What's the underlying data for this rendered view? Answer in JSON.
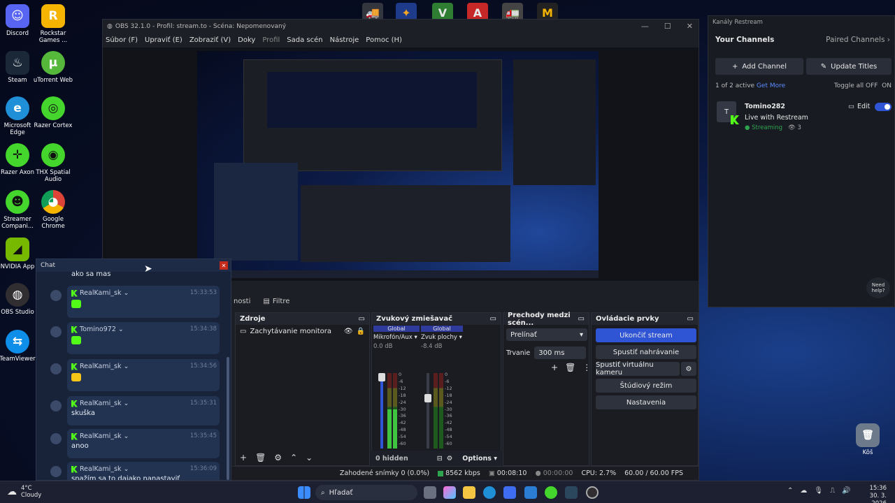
{
  "desktop": {
    "icons": [
      {
        "label": "Discord",
        "color": "#5865f2",
        "glyph": "☺"
      },
      {
        "label": "Rockstar Games ...",
        "color": "#f5b400",
        "glyph": "R"
      },
      {
        "label": "Steam",
        "color": "#1b2838",
        "glyph": "♨"
      },
      {
        "label": "uTorrent Web",
        "color": "#55b83a",
        "glyph": "μ"
      },
      {
        "label": "Microsoft Edge",
        "color": "#1f8fd8",
        "glyph": "e"
      },
      {
        "label": "Razer Cortex",
        "color": "#44d62c",
        "glyph": "◎"
      },
      {
        "label": "Razer Axon",
        "color": "#44d62c",
        "glyph": "✛"
      },
      {
        "label": "THX Spatial Audio",
        "color": "#44d62c",
        "glyph": "◉"
      },
      {
        "label": "Streamer Compani...",
        "color": "#44d62c",
        "glyph": "☻"
      },
      {
        "label": "Google Chrome",
        "color": "#db4437",
        "glyph": "◕"
      },
      {
        "label": "NVIDIA App",
        "color": "#76b900",
        "glyph": "◢"
      },
      {
        "label": "OBS Studio",
        "color": "#302e31",
        "glyph": "◍"
      },
      {
        "label": "TeamViewer",
        "color": "#0e8ee9",
        "glyph": "⇆"
      },
      {
        "label": "Kôš",
        "color": "#6c7a8c",
        "glyph": "🗑"
      }
    ]
  },
  "obs": {
    "title": "OBS 32.1.0 - Profil: stream.to - Scéna: Nepomenovaný",
    "menu": [
      "Súbor (F)",
      "Upraviť (E)",
      "Zobraziť (V)",
      "Doky",
      "Profil",
      "Sada scén",
      "Nástroje",
      "Pomoc (H)"
    ],
    "tabs": {
      "scenes_partial": "nosti",
      "filters": "Filtre"
    },
    "sources": {
      "title": "Zdroje",
      "items": [
        {
          "name": "Zachytávanie monitora"
        }
      ]
    },
    "mixer": {
      "title": "Zvukový zmiešavač",
      "channels": [
        {
          "scope": "Global",
          "name": "Mikrofón/Aux",
          "db": "0.0 dB",
          "level": 0.52
        },
        {
          "scope": "Global",
          "name": "Zvuk plochy",
          "db": "-8.4 dB",
          "level": 0.0
        }
      ],
      "scale": [
        "0",
        "-6",
        "-12",
        "-18",
        "-24",
        "-30",
        "-36",
        "-42",
        "-48",
        "-54",
        "-60"
      ],
      "hidden": "0 hidden",
      "options": "Options"
    },
    "transitions": {
      "title": "Prechody medzi scén...",
      "selected": "Prelínať",
      "duration_label": "Trvanie",
      "duration": "300 ms"
    },
    "controls": {
      "title": "Ovládacie prvky",
      "stop_stream": "Ukončiť stream",
      "start_recording": "Spustiť nahrávanie",
      "start_virtualcam": "Spustiť virtuálnu kameru",
      "studio_mode": "Štúdiový režim",
      "settings": "Nastavenia"
    },
    "status": {
      "dropped": "Zahodené snímky 0 (0.0%)",
      "bitrate": "8562 kbps",
      "stream_time": "00:08:10",
      "rec_time": "00:00:00",
      "cpu": "CPU: 2.7%",
      "fps": "60.00 / 60.00 FPS"
    }
  },
  "chat": {
    "title": "Chat",
    "first_text": "ako sa mas",
    "messages": [
      {
        "user": "RealKami_sk",
        "time": "15:33:53",
        "text": "",
        "emote": true
      },
      {
        "user": "Tomino972",
        "time": "15:34:38",
        "text": "",
        "emote": true
      },
      {
        "user": "RealKami_sk",
        "time": "15:34:56",
        "text": "",
        "emote": true
      },
      {
        "user": "RealKami_sk",
        "time": "15:35:31",
        "text": "skuška",
        "emote": false
      },
      {
        "user": "RealKami_sk",
        "time": "15:35:45",
        "text": "anoo",
        "emote": false
      },
      {
        "user": "RealKami_sk",
        "time": "15:36:09",
        "text": "snažím sa to dajako nanastaviť",
        "emote": false
      }
    ]
  },
  "restream": {
    "window_title": "Kanály Restream",
    "heading": "Your Channels",
    "paired": "Paired Channels",
    "add_channel": "Add Channel",
    "update_titles": "Update Titles",
    "active": "1 of 2 active",
    "get_more": "Get More",
    "toggle_all": "Toggle all OFF",
    "toggle_state": "ON",
    "channel": {
      "avatar": "T",
      "name": "Tomino282",
      "title": "Live with Restream",
      "status": "Streaming",
      "viewers": "3",
      "edit": "Edit"
    },
    "help": "Need help?"
  },
  "taskbar": {
    "weather_temp": "4°C",
    "weather_desc": "Cloudy",
    "search": "Hľadať",
    "time": "15:36",
    "date": "30. 3. 2026"
  },
  "colors": {
    "accent": "#2f55d4",
    "kick_green": "#53fc18",
    "streaming_green": "#2ea44f"
  }
}
